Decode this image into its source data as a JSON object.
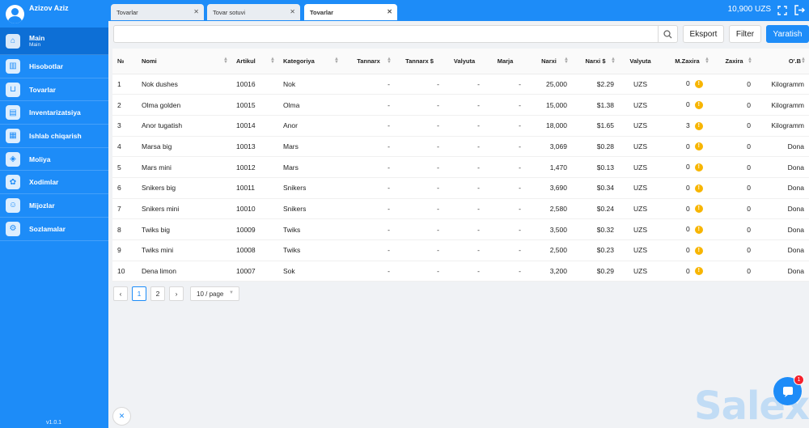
{
  "user": {
    "name": "Azizov Aziz"
  },
  "sidebar": {
    "items": [
      {
        "label": "Main",
        "sublabel": "Main",
        "icon": "home-icon",
        "active": true
      },
      {
        "label": "Hisobotlar",
        "icon": "chart-icon"
      },
      {
        "label": "Tovarlar",
        "icon": "basket-icon"
      },
      {
        "label": "Inventarizatsiya",
        "icon": "clipboard-icon"
      },
      {
        "label": "Ishlab chiqarish",
        "icon": "factory-icon"
      },
      {
        "label": "Moliya",
        "icon": "wallet-icon"
      },
      {
        "label": "Xodimlar",
        "icon": "staff-icon"
      },
      {
        "label": "Mijozlar",
        "icon": "clients-icon"
      },
      {
        "label": "Sozlamalar",
        "icon": "gear-icon"
      }
    ],
    "version": "v1.0.1"
  },
  "tabs": [
    {
      "label": "Tovarlar"
    },
    {
      "label": "Tovar sotuvi"
    },
    {
      "label": "Tovarlar"
    }
  ],
  "header": {
    "balance": "10,900 UZS"
  },
  "toolbar": {
    "search_placeholder": "",
    "export_label": "Eksport",
    "filter_label": "Filter",
    "create_label": "Yaratish"
  },
  "table": {
    "columns": [
      "№",
      "Nomi",
      "Artikul",
      "Kategoriya",
      "Tannarx",
      "Tannarx $",
      "Valyuta",
      "Marja",
      "Narxi",
      "Narxi $",
      "Valyuta",
      "M.Zaxira",
      "Zaxira",
      "O'.B"
    ],
    "rows": [
      {
        "n": "1",
        "name": "Nok dushes",
        "sku": "10016",
        "category": "Nok",
        "cost": "-",
        "cost_usd": "-",
        "cost_cur": "-",
        "margin": "-",
        "price": "25,000",
        "price_usd": "$2.29",
        "price_cur": "UZS",
        "min_stock": "0",
        "stock": "0",
        "unit": "Kilogramm"
      },
      {
        "n": "2",
        "name": "Olma golden",
        "sku": "10015",
        "category": "Olma",
        "cost": "-",
        "cost_usd": "-",
        "cost_cur": "-",
        "margin": "-",
        "price": "15,000",
        "price_usd": "$1.38",
        "price_cur": "UZS",
        "min_stock": "0",
        "stock": "0",
        "unit": "Kilogramm"
      },
      {
        "n": "3",
        "name": "Anor tugatish",
        "sku": "10014",
        "category": "Anor",
        "cost": "-",
        "cost_usd": "-",
        "cost_cur": "-",
        "margin": "-",
        "price": "18,000",
        "price_usd": "$1.65",
        "price_cur": "UZS",
        "min_stock": "3",
        "stock": "0",
        "unit": "Kilogramm"
      },
      {
        "n": "4",
        "name": "Marsa big",
        "sku": "10013",
        "category": "Mars",
        "cost": "-",
        "cost_usd": "-",
        "cost_cur": "-",
        "margin": "-",
        "price": "3,069",
        "price_usd": "$0.28",
        "price_cur": "UZS",
        "min_stock": "0",
        "stock": "0",
        "unit": "Dona"
      },
      {
        "n": "5",
        "name": "Mars mini",
        "sku": "10012",
        "category": "Mars",
        "cost": "-",
        "cost_usd": "-",
        "cost_cur": "-",
        "margin": "-",
        "price": "1,470",
        "price_usd": "$0.13",
        "price_cur": "UZS",
        "min_stock": "0",
        "stock": "0",
        "unit": "Dona"
      },
      {
        "n": "6",
        "name": "Snikers big",
        "sku": "10011",
        "category": "Snikers",
        "cost": "-",
        "cost_usd": "-",
        "cost_cur": "-",
        "margin": "-",
        "price": "3,690",
        "price_usd": "$0.34",
        "price_cur": "UZS",
        "min_stock": "0",
        "stock": "0",
        "unit": "Dona"
      },
      {
        "n": "7",
        "name": "Snikers mini",
        "sku": "10010",
        "category": "Snikers",
        "cost": "-",
        "cost_usd": "-",
        "cost_cur": "-",
        "margin": "-",
        "price": "2,580",
        "price_usd": "$0.24",
        "price_cur": "UZS",
        "min_stock": "0",
        "stock": "0",
        "unit": "Dona"
      },
      {
        "n": "8",
        "name": "Twiks big",
        "sku": "10009",
        "category": "Twiks",
        "cost": "-",
        "cost_usd": "-",
        "cost_cur": "-",
        "margin": "-",
        "price": "3,500",
        "price_usd": "$0.32",
        "price_cur": "UZS",
        "min_stock": "0",
        "stock": "0",
        "unit": "Dona"
      },
      {
        "n": "9",
        "name": "Twiks mini",
        "sku": "10008",
        "category": "Twiks",
        "cost": "-",
        "cost_usd": "-",
        "cost_cur": "-",
        "margin": "-",
        "price": "2,500",
        "price_usd": "$0.23",
        "price_cur": "UZS",
        "min_stock": "0",
        "stock": "0",
        "unit": "Dona"
      },
      {
        "n": "10",
        "name": "Dena limon",
        "sku": "10007",
        "category": "Sok",
        "cost": "-",
        "cost_usd": "-",
        "cost_cur": "-",
        "margin": "-",
        "price": "3,200",
        "price_usd": "$0.29",
        "price_cur": "UZS",
        "min_stock": "0",
        "stock": "0",
        "unit": "Dona"
      }
    ]
  },
  "pagination": {
    "pages": [
      "1",
      "2"
    ],
    "current": "1",
    "page_size": "10 / page"
  },
  "chat": {
    "badge": "1"
  },
  "brand": {
    "watermark": "Salexy"
  },
  "colors": {
    "primary": "#1d8cf8",
    "warning": "#f7b500",
    "badge": "#f5222d"
  }
}
